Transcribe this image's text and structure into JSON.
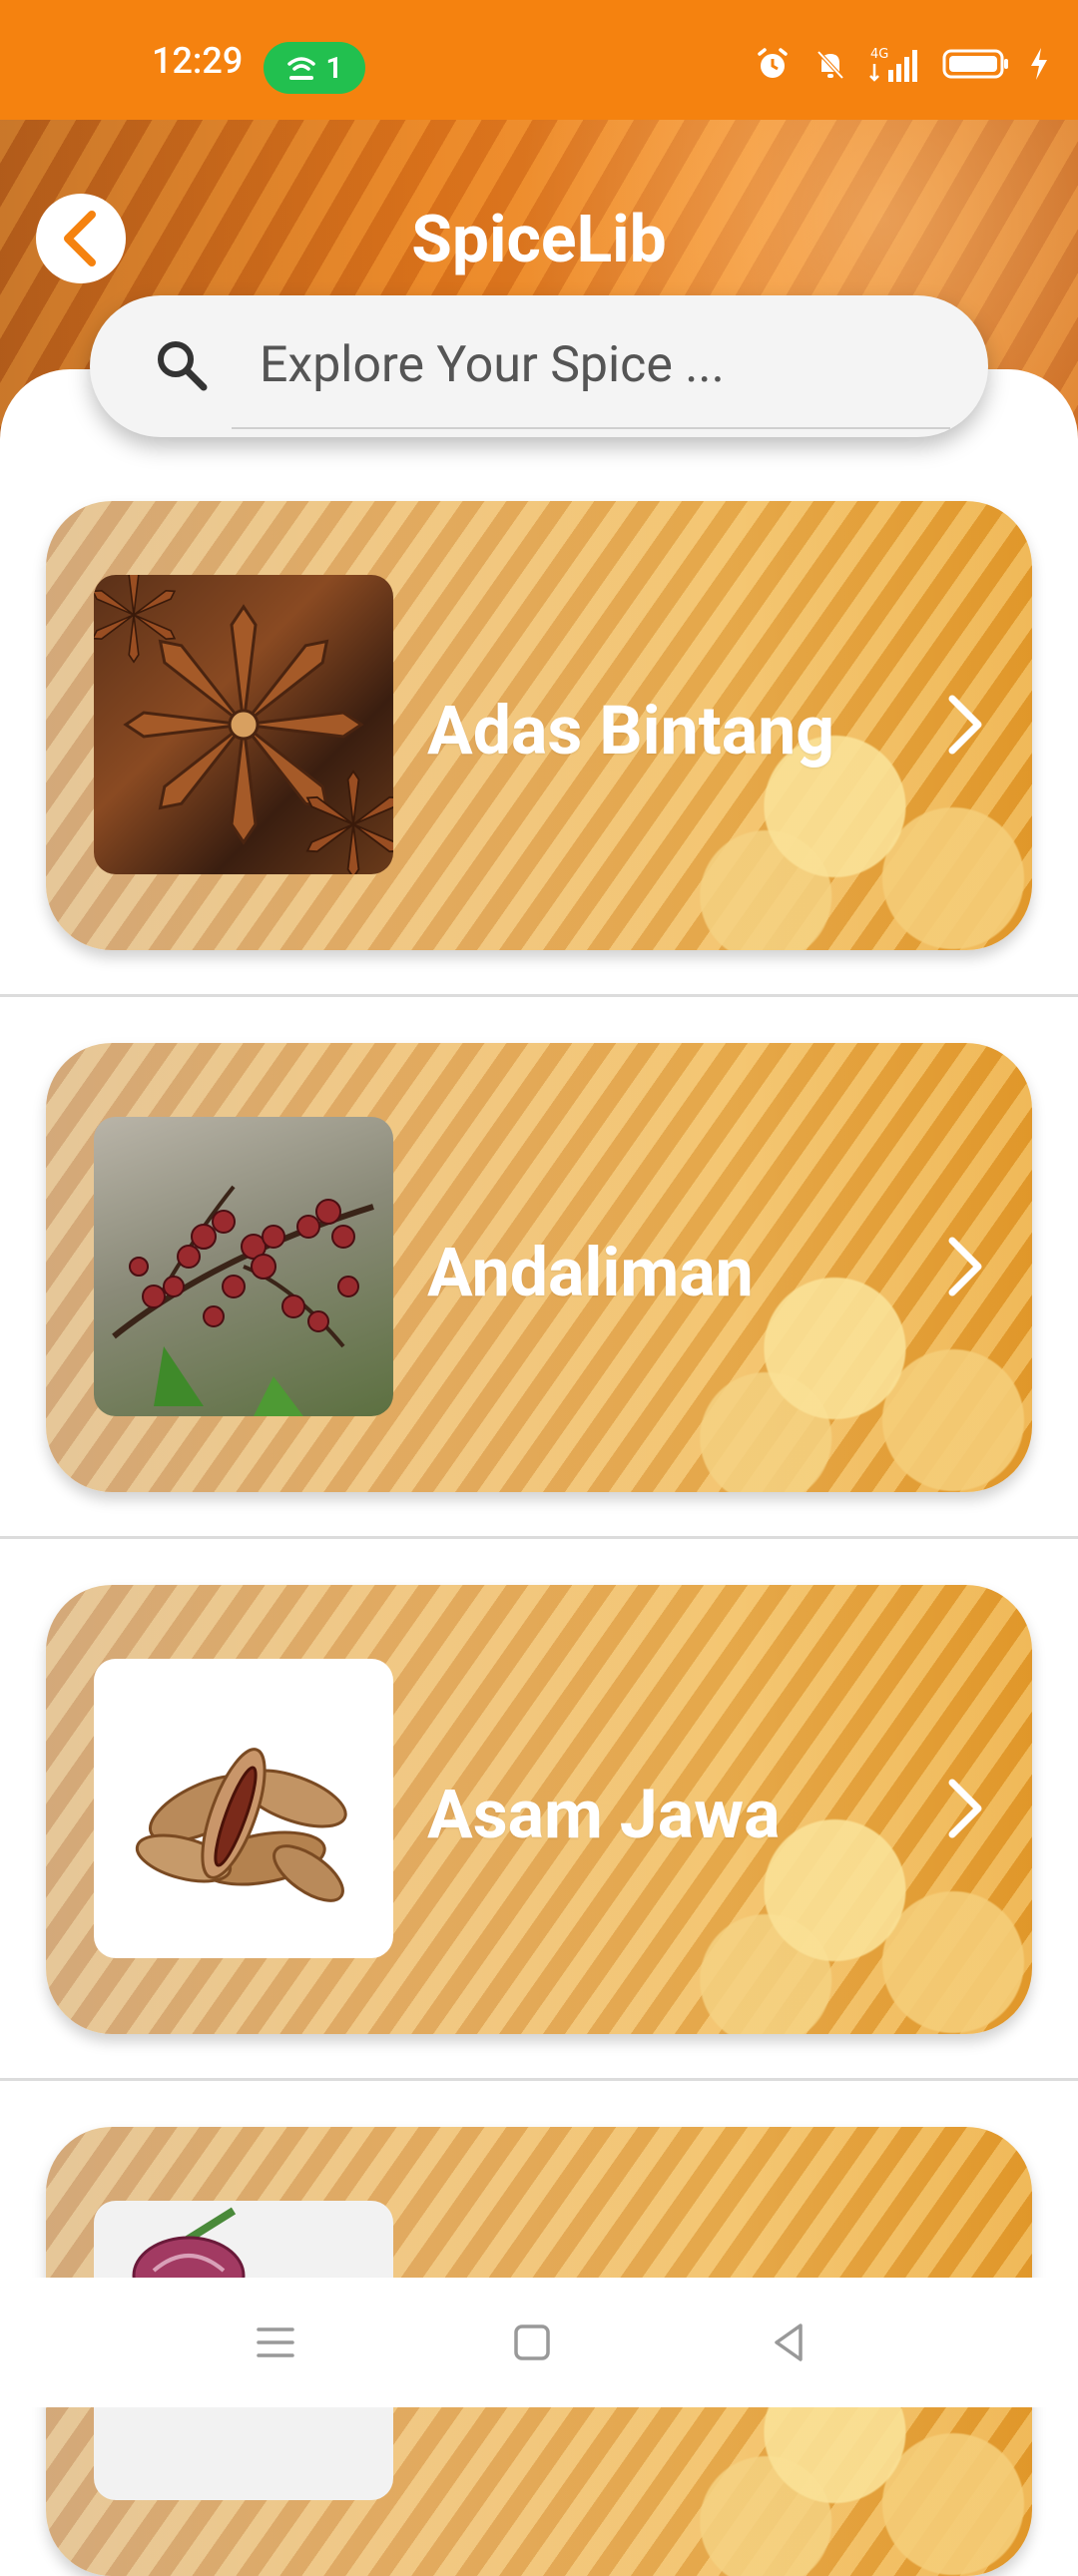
{
  "status_bar": {
    "time": "12:29",
    "hotspot_count": "1",
    "network": "4G",
    "icons": [
      "alarm-icon",
      "mute-bell-icon",
      "signal-icon",
      "battery-icon",
      "charging-icon"
    ]
  },
  "header": {
    "title": "SpiceLib",
    "back_icon": "chevron-left-icon"
  },
  "search": {
    "placeholder": "Explore Your Spice ...",
    "value": ""
  },
  "spices": [
    {
      "name": "Adas Bintang"
    },
    {
      "name": "Andaliman"
    },
    {
      "name": "Asam Jawa"
    },
    {
      "name": ""
    }
  ],
  "nav": {
    "icons": [
      "menu-icon",
      "home-square-icon",
      "back-triangle-icon"
    ]
  },
  "colors": {
    "accent": "#f5820f",
    "hotspot": "#22c04f",
    "card_gradient_end": "#e89e28"
  }
}
